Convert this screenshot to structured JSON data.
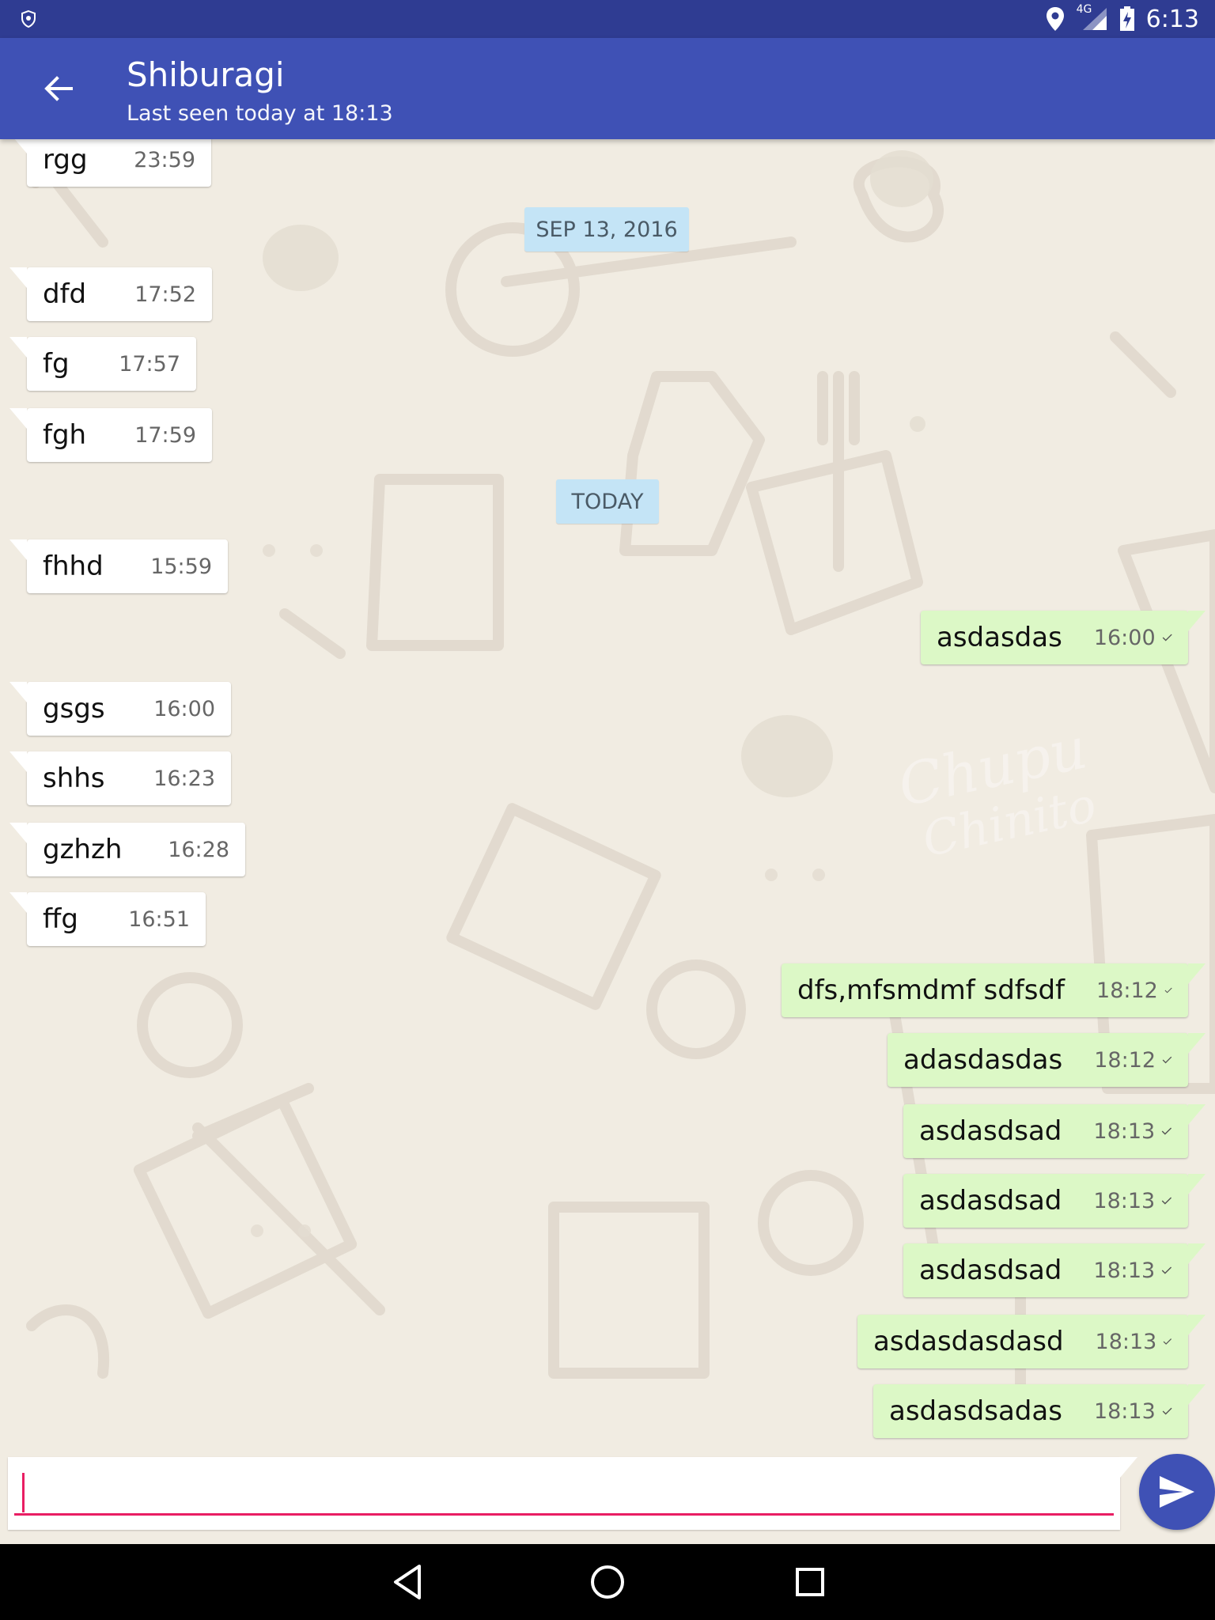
{
  "status_bar": {
    "time": "6:13",
    "network": "4G"
  },
  "header": {
    "title": "Shiburagi",
    "subtitle": "Last seen today at 18:13"
  },
  "date_chips": [
    "SEP 13, 2016",
    "TODAY"
  ],
  "incoming": [
    {
      "text": "rgg",
      "time": "23:59"
    },
    {
      "text": "dfd",
      "time": "17:52"
    },
    {
      "text": "fg",
      "time": "17:57"
    },
    {
      "text": "fgh",
      "time": "17:59"
    },
    {
      "text": "fhhd",
      "time": "15:59"
    },
    {
      "text": "gsgs",
      "time": "16:00"
    },
    {
      "text": "shhs",
      "time": "16:23"
    },
    {
      "text": "gzhzh",
      "time": "16:28"
    },
    {
      "text": "ffg",
      "time": "16:51"
    }
  ],
  "outgoing": [
    {
      "text": "asdasdas",
      "time": "16:00"
    },
    {
      "text": "dfs,mfsmdmf sdfsdf",
      "time": "18:12"
    },
    {
      "text": "adasdasdas",
      "time": "18:12"
    },
    {
      "text": "asdasdsad",
      "time": "18:13"
    },
    {
      "text": "asdasdsad",
      "time": "18:13"
    },
    {
      "text": "asdasdsad",
      "time": "18:13"
    },
    {
      "text": "asdasdasdasd",
      "time": "18:13"
    },
    {
      "text": "asdasdsadas",
      "time": "18:13"
    }
  ],
  "composer": {
    "value": "",
    "placeholder": ""
  },
  "colors": {
    "app_bar": "#3f51b5",
    "status_bar": "#2f3c92",
    "outgoing_bubble": "#dcf8c6",
    "incoming_bubble": "#ffffff",
    "date_chip": "#c4e4f6",
    "accent": "#e91e63",
    "chat_background": "#f1ece2"
  },
  "icons": {
    "back": "arrow-left-icon",
    "send": "send-icon",
    "read_receipt": "check-icon",
    "nav_back": "triangle-back-icon",
    "nav_home": "circle-home-icon",
    "nav_recents": "square-recents-icon"
  }
}
